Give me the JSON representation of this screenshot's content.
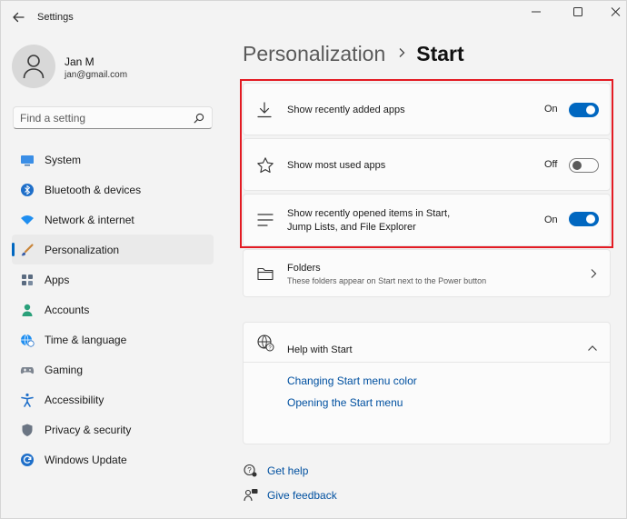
{
  "window": {
    "title": "Settings",
    "back_icon": "arrow-left-icon",
    "controls": [
      "minimize-icon",
      "maximize-icon",
      "close-icon"
    ]
  },
  "profile": {
    "name": "Jan M",
    "email": "jan@gmail.com",
    "avatar_icon": "person-icon"
  },
  "search": {
    "placeholder": "Find a setting",
    "value": "",
    "icon": "search-icon"
  },
  "sidebar": {
    "items": [
      {
        "label": "System",
        "icon": "monitor-icon",
        "active": false
      },
      {
        "label": "Bluetooth & devices",
        "icon": "bluetooth-icon",
        "active": false
      },
      {
        "label": "Network & internet",
        "icon": "wifi-icon",
        "active": false
      },
      {
        "label": "Personalization",
        "icon": "brush-icon",
        "active": true
      },
      {
        "label": "Apps",
        "icon": "apps-grid-icon",
        "active": false
      },
      {
        "label": "Accounts",
        "icon": "account-icon",
        "active": false
      },
      {
        "label": "Time & language",
        "icon": "globe-clock-icon",
        "active": false
      },
      {
        "label": "Gaming",
        "icon": "gamepad-icon",
        "active": false
      },
      {
        "label": "Accessibility",
        "icon": "accessibility-icon",
        "active": false
      },
      {
        "label": "Privacy & security",
        "icon": "shield-icon",
        "active": false
      },
      {
        "label": "Windows Update",
        "icon": "refresh-icon",
        "active": false
      }
    ]
  },
  "breadcrumb": {
    "parent": "Personalization",
    "current": "Start"
  },
  "settings": [
    {
      "label": "Show recently added apps",
      "state": "On",
      "on": true,
      "icon": "download-icon"
    },
    {
      "label": "Show most used apps",
      "state": "Off",
      "on": false,
      "icon": "star-icon"
    },
    {
      "label_line1": "Show recently opened items in Start,",
      "label_line2": "Jump Lists, and File Explorer",
      "state": "On",
      "on": true,
      "icon": "list-icon"
    }
  ],
  "folders": {
    "title": "Folders",
    "subtitle": "These folders appear on Start next to the Power button",
    "icon": "folder-icon"
  },
  "help": {
    "title": "Help with Start",
    "icon": "globe-help-icon",
    "links": [
      "Changing Start menu color",
      "Opening the Start menu"
    ]
  },
  "footer": {
    "get_help": "Get help",
    "give_feedback": "Give feedback"
  },
  "colors": {
    "accent": "#0067c0",
    "highlight": "#e31b23",
    "link": "#0050a0"
  }
}
